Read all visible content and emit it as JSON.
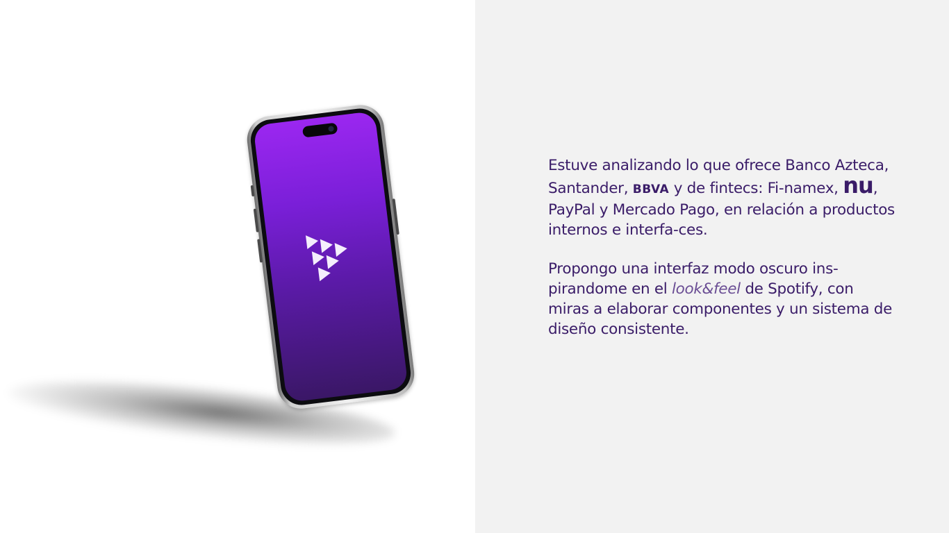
{
  "paragraph1": {
    "part1": "Estuve analizando lo que ofrece Banco Azteca, Santander, ",
    "bbva": "BBVA",
    "part2": " y de fintecs: Fi-namex, ",
    "nu": "nu",
    "part3": ", PayPal y Mercado Pago, en relación a productos internos e interfa-ces."
  },
  "paragraph2": {
    "part1": "Propongo una interfaz modo oscuro ins-pirandome en el ",
    "emphasis": "look&feel",
    "part2": " de Spotify, con miras a elaborar componentes y un sistema de diseño consistente."
  },
  "colors": {
    "text": "#3a1c68",
    "right_background": "#f2f2f2",
    "screen_gradient_top": "#9b27f0",
    "screen_gradient_bottom": "#3a1766"
  },
  "icons": {
    "app_logo": "stacked-triangles-logo",
    "device": "smartphone-mockup"
  }
}
